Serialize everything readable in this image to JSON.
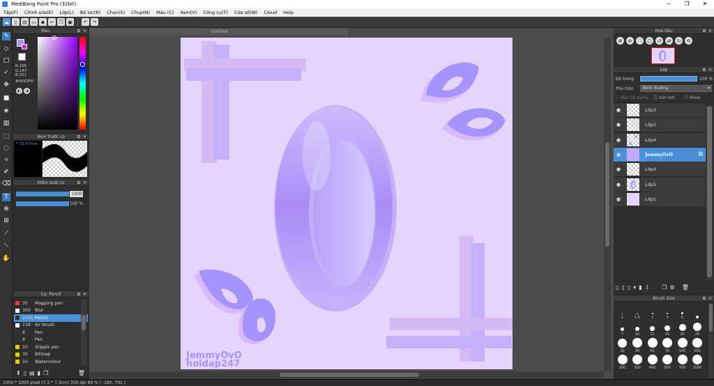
{
  "window": {
    "title": "MediBang Paint Pro (32bit)",
    "minimize": "─",
    "maximize": "❐",
    "close": "✕"
  },
  "menu": [
    "Tệp(F)",
    "Chỉnh sửa(E)",
    "Lớp(L)",
    "Bộ lọc(R)",
    "Chọn(S)",
    "Chụp(N)",
    "Màu (C)",
    "Xem(V)",
    "Công cụ(T)",
    "Cửa sổ(W)",
    "Cloud",
    "Help"
  ],
  "document": {
    "tab": "Untitled"
  },
  "color_panel": {
    "title": "Màu",
    "r": "R:166",
    "g": "G:147",
    "b": "B:251",
    "hex": "#A693FB",
    "fg_color": "#a693fb",
    "bg_color": "#ffffff"
  },
  "preview_panel": {
    "title": "Xem trước cọ",
    "size": "* 72.57mm"
  },
  "brush_control": {
    "title": "Kiểm soát cọ",
    "size_value": "1000",
    "opacity_value": "100 %"
  },
  "brush_panel": {
    "title": "Cọ: Pencil",
    "items": [
      {
        "size": "35",
        "name": "Mapping pen",
        "color": "#e33",
        "selected": false
      },
      {
        "size": "300",
        "name": "Blur",
        "color": "#f5f5f5",
        "selected": false
      },
      {
        "size": "1000",
        "name": "Pencil",
        "color": "#333",
        "selected": true
      },
      {
        "size": "138",
        "name": "Air brush",
        "color": "#f5f5f5",
        "selected": false
      },
      {
        "size": "8",
        "name": "Pen",
        "color": "#333",
        "selected": false
      },
      {
        "size": "8",
        "name": "Pen",
        "color": "#333",
        "selected": false
      },
      {
        "size": "50",
        "name": "Stipple pen",
        "color": "#e6c800",
        "selected": false
      },
      {
        "size": "30",
        "name": "Bitmap",
        "color": "#e6c800",
        "selected": false
      },
      {
        "size": "50",
        "name": "Watercolour",
        "color": "#e6c800",
        "selected": false
      }
    ]
  },
  "navigator": {
    "title": "Hoa tiêu"
  },
  "layer_panel": {
    "title": "Lớp",
    "opacity_label": "Độ trong",
    "opacity_value": "100 %",
    "blend_label": "Pha trộn",
    "blend_value": "Bình thường",
    "protect_alpha": "Bảo vệ alpha",
    "clipping": "Xén bớt",
    "lock": "Khóa",
    "layers": [
      {
        "name": "Lớp3",
        "selected": false
      },
      {
        "name": "Lớp2",
        "selected": false
      },
      {
        "name": "Lớp4",
        "selected": false
      },
      {
        "name": "JemmyOvO",
        "selected": true
      },
      {
        "name": "Lớp4",
        "selected": false
      },
      {
        "name": "Lớp5",
        "selected": false
      },
      {
        "name": "Lớp1",
        "selected": false
      }
    ]
  },
  "brush_size_panel": {
    "title": "Brush Size",
    "sizes": [
      "1",
      "1.5",
      "2",
      "3",
      "5",
      "",
      "7",
      "10",
      "12",
      "15",
      "20",
      "25",
      "30",
      "40",
      "50",
      "70",
      "100",
      "150",
      "200",
      "300",
      "400",
      "500",
      "700",
      "1000"
    ]
  },
  "canvas_text": {
    "signature1": "JemmyOvO",
    "signature2": "hoidap247"
  },
  "status": {
    "text": "1000 * 1000 pixel   (7.3 * 7.3cm)   350 dpi   89 %   ( -180, 791 )"
  },
  "colors": {
    "accent": "#4a90d8",
    "canvas_bg": "#e5d5fc",
    "shape_main": "#a693fb",
    "shape_shadow": "#d8b8ff"
  }
}
